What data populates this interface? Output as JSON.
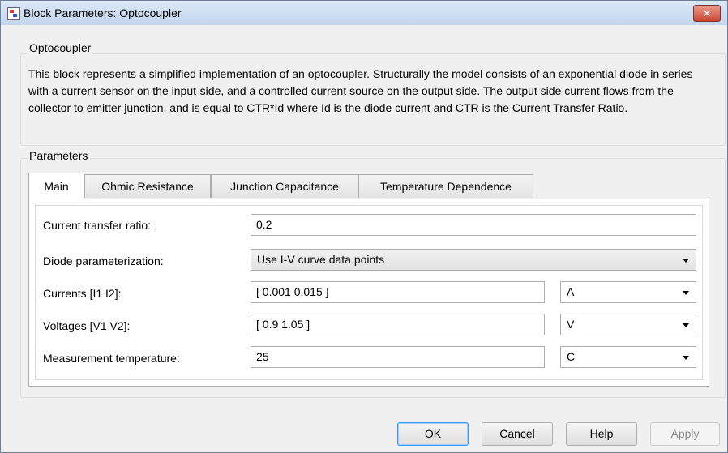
{
  "window": {
    "title": "Block Parameters: Optocoupler",
    "close_symbol": "✕"
  },
  "block": {
    "group_title": "Optocoupler",
    "description": "This block represents a simplified implementation of an optocoupler. Structurally the model consists of an exponential diode in series with a current sensor on the input-side, and a controlled current source on the output side. The output side current flows from the collector to emitter junction, and is equal to CTR*Id where Id is the diode current and CTR is the Current Transfer Ratio."
  },
  "parameters": {
    "group_title": "Parameters",
    "tabs": [
      {
        "label": "Main",
        "active": true
      },
      {
        "label": "Ohmic Resistance",
        "active": false
      },
      {
        "label": "Junction Capacitance",
        "active": false
      },
      {
        "label": "Temperature Dependence",
        "active": false
      }
    ],
    "rows": {
      "ctr": {
        "label": "Current transfer ratio:",
        "value": "0.2"
      },
      "diode": {
        "label": "Diode parameterization:",
        "selected": "Use I-V curve data points"
      },
      "currents": {
        "label": "Currents [I1 I2]:",
        "value": "[ 0.001 0.015 ]",
        "unit": "A"
      },
      "voltages": {
        "label": "Voltages [V1 V2]:",
        "value": "[ 0.9 1.05 ]",
        "unit": "V"
      },
      "temperature": {
        "label": "Measurement temperature:",
        "value": "25",
        "unit": "C"
      }
    }
  },
  "buttons": {
    "ok": "OK",
    "cancel": "Cancel",
    "help": "Help",
    "apply": "Apply"
  },
  "colors": {
    "titlebar": "#c3d6ee",
    "close_button": "#c8462f",
    "default_button_border": "#3399ff"
  },
  "icons": {
    "app": "simulink-block-icon",
    "close": "close-icon",
    "dropdown": "chevron-down-icon"
  }
}
